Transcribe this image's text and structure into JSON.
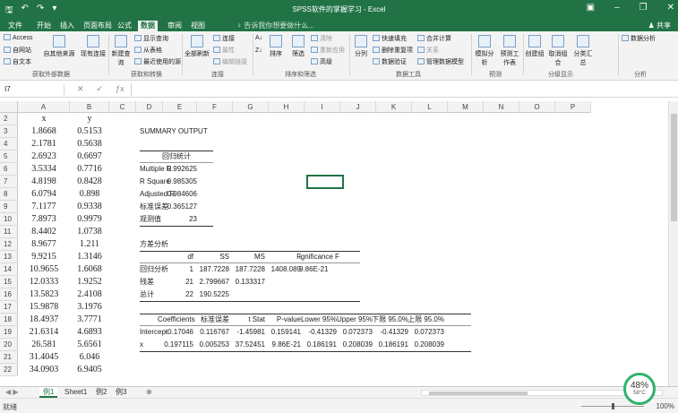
{
  "window": {
    "title": "SPSS软件的掌握学习 - Excel"
  },
  "tabs": [
    {
      "label": "文件"
    },
    {
      "label": "开始"
    },
    {
      "label": "插入"
    },
    {
      "label": "页面布局"
    },
    {
      "label": "公式"
    },
    {
      "label": "数据"
    },
    {
      "label": "审阅"
    },
    {
      "label": "视图"
    }
  ],
  "tell_me": "告诉我你想要做什么...",
  "share": "共享",
  "ribbon": {
    "get_external": {
      "label": "获取外部数据",
      "access": "Access",
      "web": "自网站",
      "text": "自文本",
      "other": "自其他来源",
      "existing": "现有连接"
    },
    "get_transform": {
      "label": "获取和转换",
      "new_query": "新建查询",
      "show_queries": "显示查询",
      "from_table": "从表格",
      "recent": "最近使用的源"
    },
    "connections": {
      "label": "连接",
      "refresh_all": "全部刷新",
      "conn": "连接",
      "props": "属性",
      "edit_links": "编辑链接"
    },
    "sort_filter": {
      "label": "排序和筛选",
      "sort": "排序",
      "filter": "筛选",
      "clear": "清除",
      "reapply": "重新应用",
      "advanced": "高级"
    },
    "data_tools": {
      "label": "数据工具",
      "split": "分列",
      "flash_fill": "快速填充",
      "remove_dup": "删除重复项",
      "validate": "数据验证",
      "consolidate": "合并计算",
      "relations": "关系",
      "manage_model": "管理数据模型"
    },
    "forecast": {
      "label": "预测",
      "what_if": "模拟分析",
      "forecast_sheet": "预测工作表"
    },
    "outline": {
      "label": "分级显示",
      "group": "创建组",
      "ungroup": "取消组合",
      "subtotal": "分类汇总"
    },
    "analysis": {
      "label": "分析",
      "data_analysis": "数据分析"
    }
  },
  "namebox": "I7",
  "columns": [
    "A",
    "B",
    "C",
    "D",
    "E",
    "F",
    "G",
    "H",
    "I",
    "J",
    "K",
    "L",
    "M",
    "N",
    "O",
    "P"
  ],
  "rows": [
    "2",
    "3",
    "4",
    "5",
    "6",
    "7",
    "8",
    "9",
    "10",
    "11",
    "12",
    "13",
    "14",
    "15",
    "16",
    "17",
    "18",
    "19",
    "20",
    "21",
    "22"
  ],
  "xy": {
    "x_header": "x",
    "y_header": "y",
    "x": [
      "1.8668",
      "2.1781",
      "2.6923",
      "3.5334",
      "4.8198",
      "6.0794",
      "7.1177",
      "7.8973",
      "8.4402",
      "8.9677",
      "9.9215",
      "10.9655",
      "12.0333",
      "13.5823",
      "15.9878",
      "18.4937",
      "21.6314",
      "26.581",
      "31.4045",
      "34.0903"
    ],
    "y": [
      "0.5153",
      "0.5638",
      "0.6697",
      "0.7716",
      "0.8428",
      "0.898",
      "0.9338",
      "0.9979",
      "1.0738",
      "1.211",
      "1.3146",
      "1.6068",
      "1.9252",
      "2.4108",
      "3.1976",
      "3.7771",
      "4.6893",
      "5.6561",
      "6.046",
      "6.9405"
    ]
  },
  "summary": {
    "title": "SUMMARY OUTPUT",
    "regression_stats_header": "回归统计",
    "stats": [
      {
        "label": "Multiple R",
        "value": "0.992625"
      },
      {
        "label": "R Square",
        "value": "0.985305"
      },
      {
        "label": "Adjusted R",
        "value": "0.984606"
      },
      {
        "label": "标准误差",
        "value": "0.365127"
      },
      {
        "label": "观测值",
        "value": "23"
      }
    ],
    "anova_title": "方差分析",
    "anova_headers": [
      "df",
      "SS",
      "MS",
      "F",
      "ignificance F"
    ],
    "anova": [
      {
        "label": "回归分析",
        "df": "1",
        "ss": "187.7228",
        "ms": "187.7228",
        "f": "1408.089",
        "sig": "9.86E-21"
      },
      {
        "label": "残差",
        "df": "21",
        "ss": "2.799667",
        "ms": "0.133317",
        "f": "",
        "sig": ""
      },
      {
        "label": "总计",
        "df": "22",
        "ss": "190.5225",
        "ms": "",
        "f": "",
        "sig": ""
      }
    ],
    "coef_headers": [
      "Coefficients",
      "标准误差",
      "t Stat",
      "P-value",
      "Lower 95%",
      "Upper 95%",
      "下限 95.0%",
      "上限 95.0%"
    ],
    "coefs": [
      {
        "label": "Intercept",
        "vals": [
          "-0.17046",
          "0.116767",
          "-1.45981",
          "0.159141",
          "-0.41329",
          "0.072373",
          "-0.41329",
          "0.072373"
        ]
      },
      {
        "label": "x",
        "vals": [
          "0.197115",
          "0.005253",
          "37.52451",
          "9.86E-21",
          "0.186191",
          "0.208039",
          "0.186191",
          "0.208039"
        ]
      }
    ]
  },
  "sheets": [
    {
      "label": "例1"
    },
    {
      "label": "Sheet1"
    },
    {
      "label": "例2"
    },
    {
      "label": "例3"
    }
  ],
  "status": {
    "ready": "就绪",
    "zoom": "100%"
  },
  "perf": {
    "percent": "48%",
    "temp": "58°C"
  }
}
